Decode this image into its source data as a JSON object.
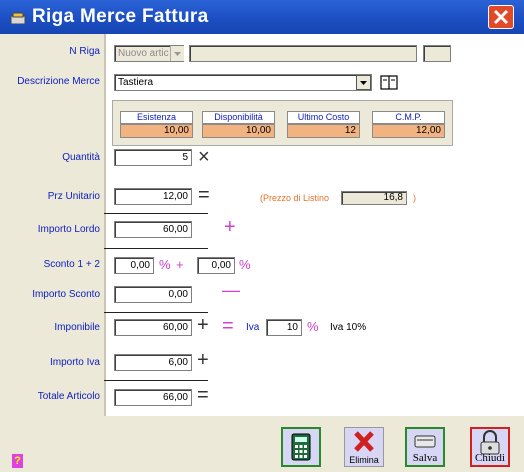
{
  "window": {
    "title": "Riga Merce Fattura"
  },
  "labels": {
    "n_riga": "N Riga",
    "descrizione": "Descrizione Merce",
    "quantita": "Quantità",
    "prz_unitario": "Prz Unitario",
    "importo_lordo": "Importo Lordo",
    "sconto": "Sconto 1 + 2",
    "importo_sconto": "Importo Sconto",
    "imponibile": "Imponibile",
    "importo_iva": "Importo Iva",
    "totale": "Totale Articolo"
  },
  "n_riga": {
    "value": "Nuovo artic"
  },
  "descrizione": {
    "value": "Tastiera"
  },
  "stats": [
    {
      "label": "Esistenza",
      "value": "10,00"
    },
    {
      "label": "Disponibilità",
      "value": "10,00"
    },
    {
      "label": "Ultimo Costo",
      "value": "12"
    },
    {
      "label": "C.M.P.",
      "value": "12,00"
    }
  ],
  "quantita": {
    "value": "5"
  },
  "prz_unitario": {
    "value": "12,00"
  },
  "listino": {
    "prefix": "(Prezzo di Listino",
    "value": "16,8",
    "suffix": ")"
  },
  "importo_lordo": {
    "value": "60,00"
  },
  "sconto": {
    "value1": "0,00",
    "pct1": "%",
    "plus": "+",
    "value2": "0,00",
    "pct2": "%"
  },
  "importo_sconto": {
    "value": "0,00"
  },
  "imponibile": {
    "value": "60,00"
  },
  "iva": {
    "label": "Iva",
    "value": "10",
    "pct": "%",
    "desc": "Iva 10%"
  },
  "importo_iva": {
    "value": "6,00"
  },
  "totale": {
    "value": "66,00"
  },
  "operators": {
    "times": "×",
    "equals": "=",
    "plus": "+",
    "minus": "—"
  },
  "buttons": {
    "elimina": "Elimina",
    "salva": "Salva",
    "chiudi": "Chiudi"
  },
  "help": {
    "label": "?"
  },
  "colors": {
    "titlebar": "#1c4fc4",
    "label_text": "#1020c0",
    "accent_magenta": "#d040d0",
    "stat_value_bg": "#f3b380"
  }
}
